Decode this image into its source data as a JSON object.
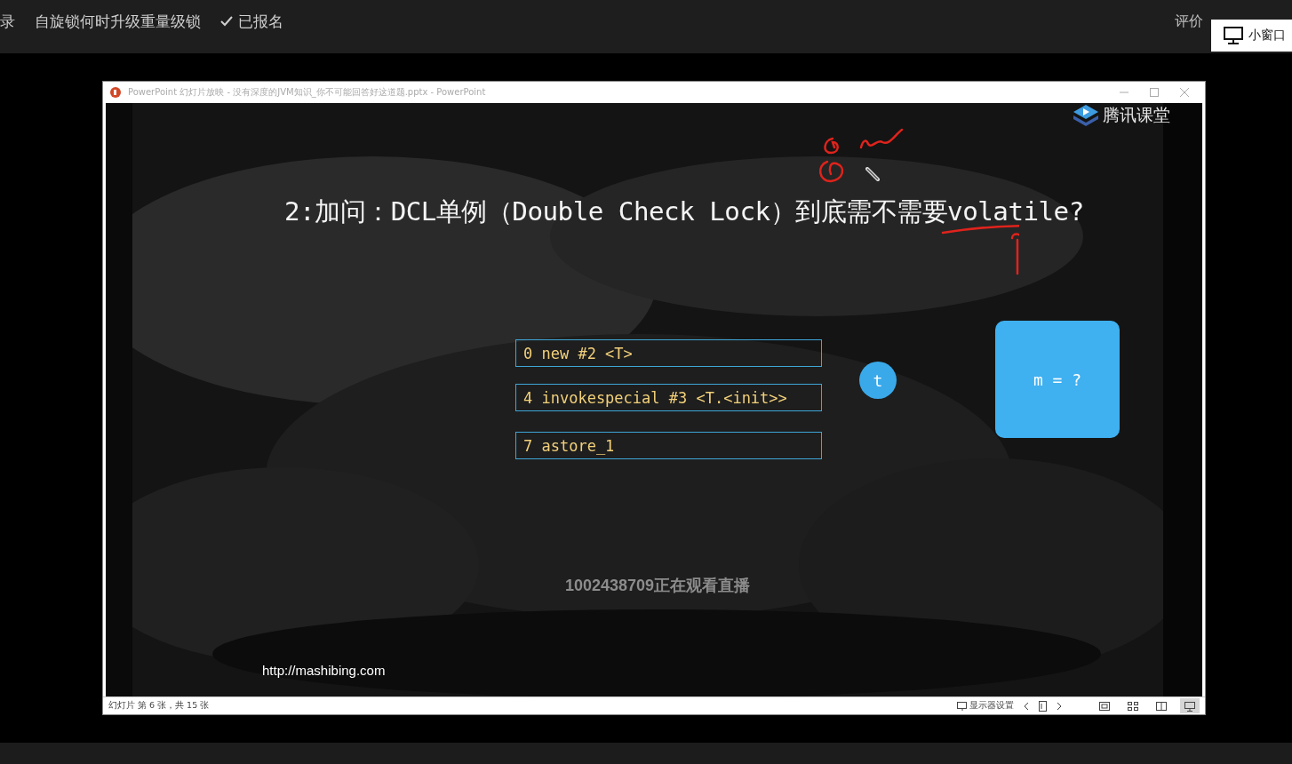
{
  "top_bar": {
    "items": [
      {
        "label": "录"
      },
      {
        "label": "自旋锁何时升级重量级锁"
      },
      {
        "label": "已报名",
        "checked": true
      }
    ],
    "right_items": [
      {
        "label": "评价"
      }
    ],
    "popup": {
      "label": "小窗口"
    }
  },
  "window": {
    "title": "PowerPoint 幻灯片放映 - 没有深度的JVM知识_你不可能回答好这道题.pptx - PowerPoint"
  },
  "slide": {
    "logo": "腾讯课堂",
    "title": "2:加问：DCL单例（Double Check Lock）到底需不需要volatile?",
    "code_lines": [
      {
        "text": "0 new #2 <T>"
      },
      {
        "text": "4 invokespecial #3 <T.<init>>"
      },
      {
        "text": "7 astore_1"
      }
    ],
    "reference": {
      "label": "t"
    },
    "object": {
      "label": "m = ?"
    },
    "url": "http://mashibing.com"
  },
  "overlay": {
    "viewers": "1002438709正在观看直播"
  },
  "status_bar": {
    "slide_info": "幻灯片 第 6 张，共 15 张",
    "display_settings": "显示器设置",
    "views": [
      {
        "kind": "normal",
        "selected": false
      },
      {
        "kind": "sorter",
        "selected": false
      },
      {
        "kind": "reading",
        "selected": false
      },
      {
        "kind": "slideshow",
        "selected": true
      }
    ]
  }
}
